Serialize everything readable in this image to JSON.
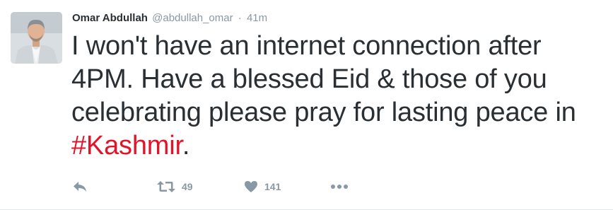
{
  "tweet": {
    "fullname": "Omar Abdullah",
    "username": "@abdullah_omar",
    "separator": "·",
    "time": "41m",
    "text_main": "I won't have an internet connection after 4PM. Have a blessed Eid & those of you celebrating please pray for lasting peace in ",
    "hashtag": "#Kashmir",
    "text_end": ".",
    "retweet_count": "49",
    "like_count": "141"
  },
  "colors": {
    "hashtag": "#e0142a",
    "muted": "#8899a6",
    "text": "#292f33"
  },
  "icons": {
    "reply": "reply-icon",
    "retweet": "retweet-icon",
    "like": "heart-icon",
    "more": "more-icon"
  }
}
